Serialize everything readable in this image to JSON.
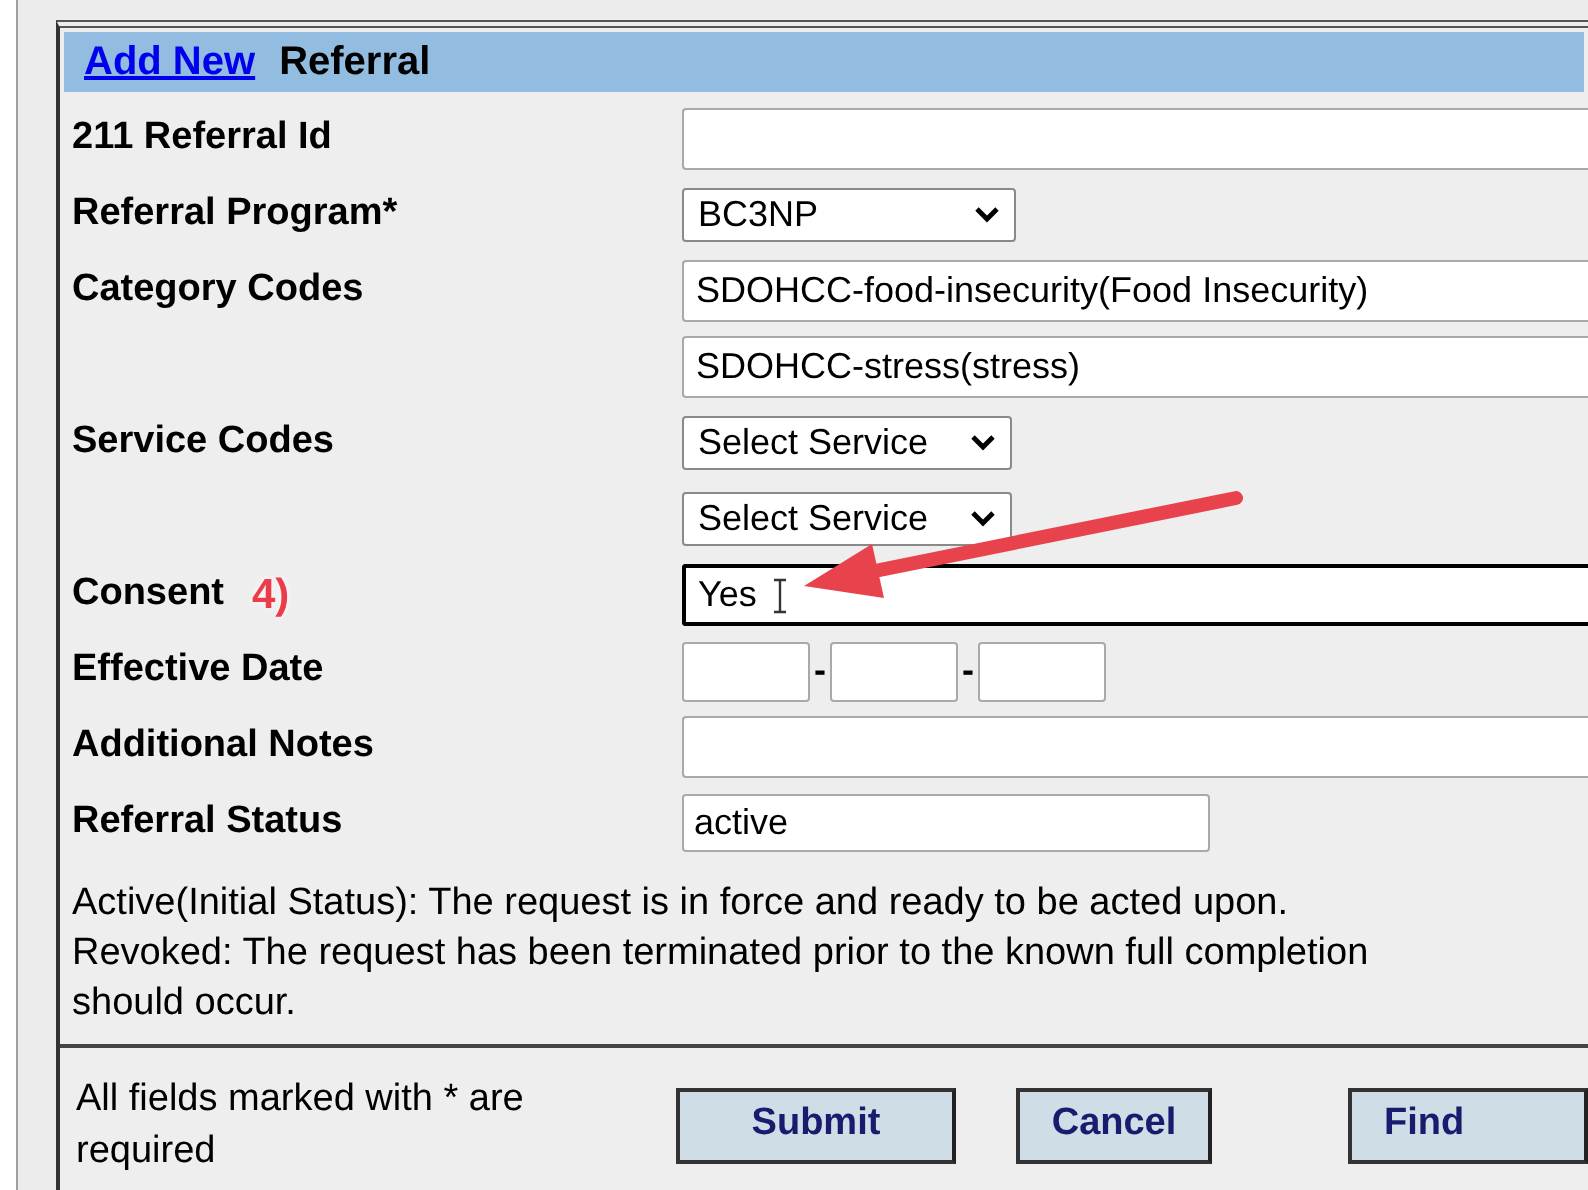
{
  "header": {
    "link": "Add New",
    "title": "Referral"
  },
  "rows": [
    {
      "label": "211 Referral Id",
      "controls": [
        {
          "kind": "wide-input"
        }
      ]
    },
    {
      "label": "Referral Program*",
      "controls": [
        {
          "kind": "select",
          "value": "BC3NP"
        }
      ]
    },
    {
      "label": "Category Codes",
      "controls": [
        {
          "kind": "wide-input",
          "value": "SDOHCC-food-insecurity(Food Insecurity)"
        }
      ]
    },
    {
      "controls": [
        {
          "kind": "wide-input",
          "value": "SDOHCC-stress(stress)"
        }
      ]
    },
    {
      "label": "Service Codes",
      "controls": [
        {
          "kind": "select",
          "value": "Select Service"
        }
      ]
    },
    {
      "controls": [
        {
          "kind": "select",
          "value": "Select Service"
        }
      ]
    },
    {
      "label": "Consent",
      "annotation": "4)",
      "controls": [
        {
          "kind": "wide-input",
          "value": "Yes",
          "focused": true
        }
      ]
    },
    {
      "label": "Effective Date",
      "controls": [
        {
          "kind": "date-box"
        },
        {
          "kind": "separator",
          "text": "-"
        },
        {
          "kind": "date-box"
        },
        {
          "kind": "separator",
          "text": "-"
        },
        {
          "kind": "date-box"
        }
      ]
    },
    {
      "label": "Additional Notes",
      "controls": [
        {
          "kind": "wide-input"
        }
      ]
    },
    {
      "label": "Referral Status",
      "controls": [
        {
          "kind": "short-input",
          "value": "active"
        }
      ]
    }
  ],
  "status_help": [
    "Active(Initial Status): The request is in force and ready to be acted upon.",
    "Revoked: The request has been terminated prior to the known full completion",
    "should occur."
  ],
  "footer": {
    "note": "All fields marked with * are required",
    "buttons": [
      "Submit",
      "Cancel",
      "Find"
    ]
  }
}
